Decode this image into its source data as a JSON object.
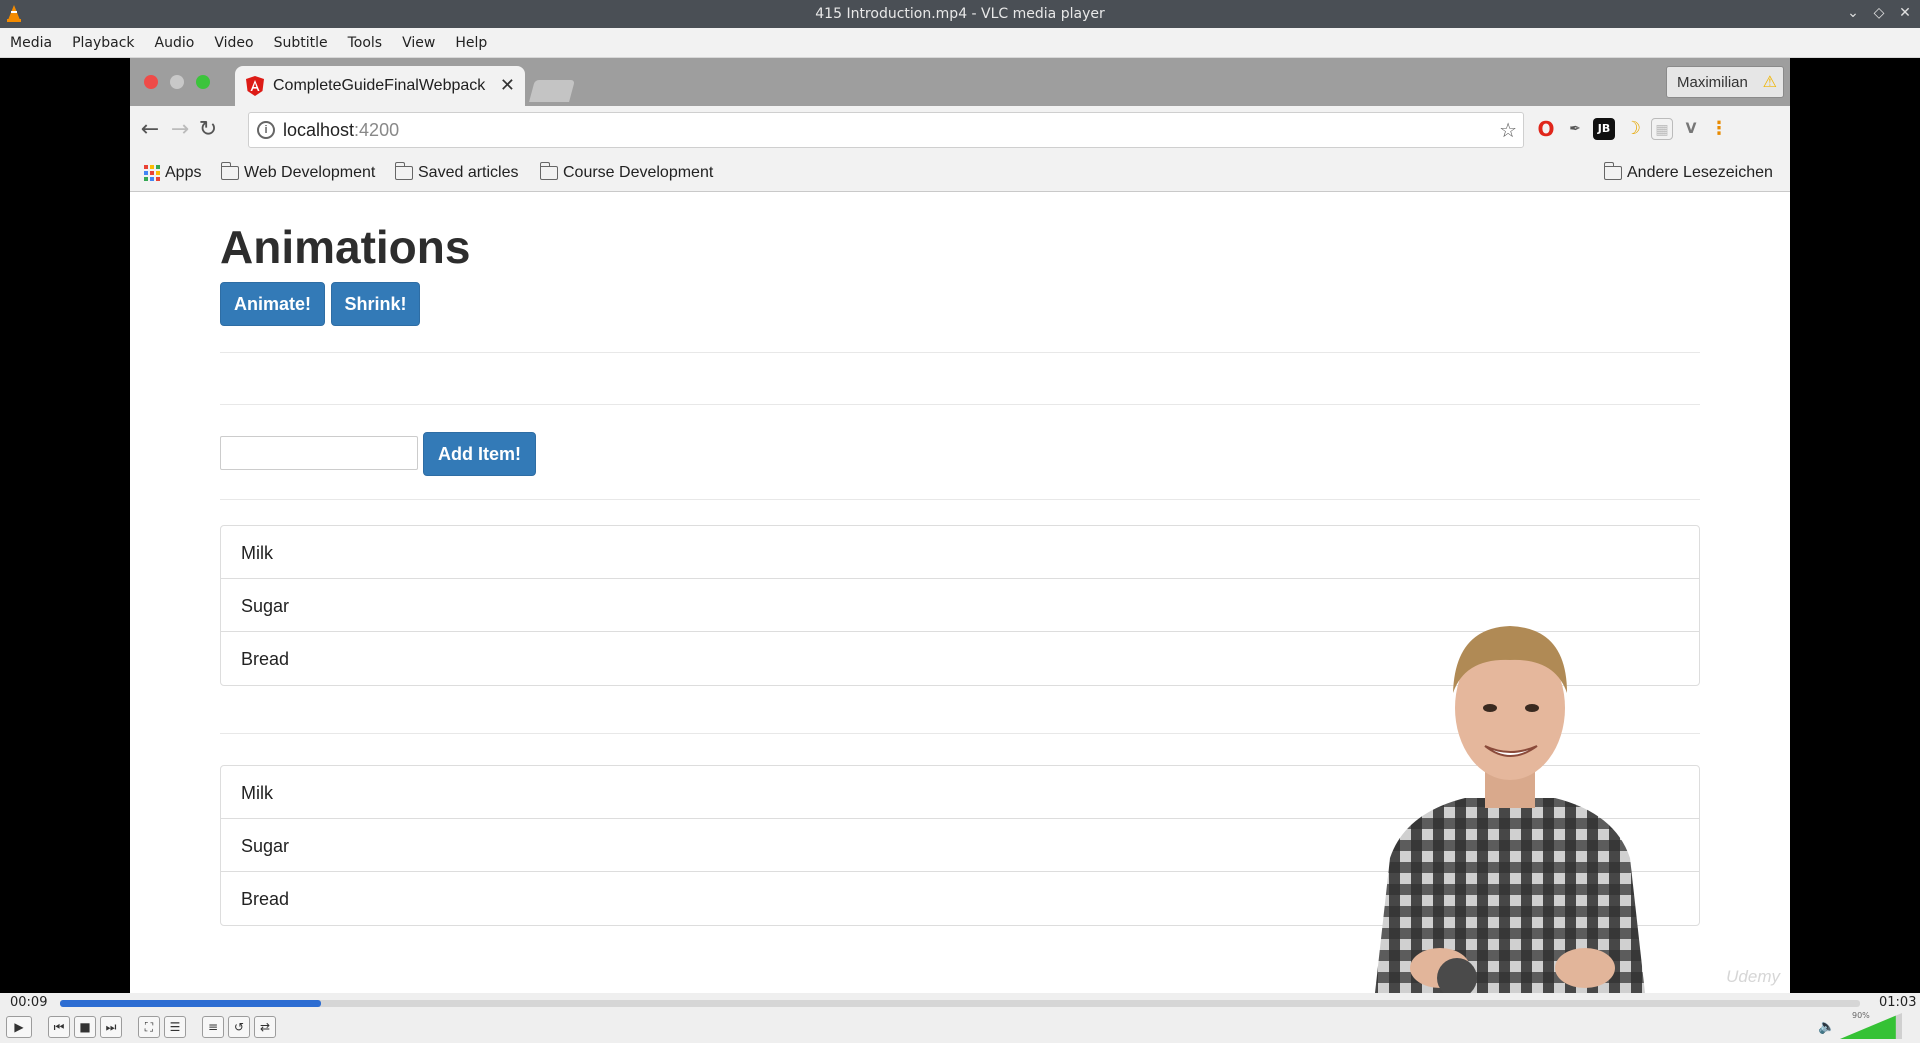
{
  "vlc": {
    "window_title": "415 Introduction.mp4 - VLC media player",
    "menu": [
      "Media",
      "Playback",
      "Audio",
      "Video",
      "Subtitle",
      "Tools",
      "View",
      "Help"
    ],
    "time_elapsed": "00:09",
    "time_total": "01:03",
    "progress": 0.145,
    "volume_label": "90%",
    "volume_level": 0.9
  },
  "browser": {
    "tab_title": "CompleteGuideFinalWebpack",
    "profile_name": "Maximilian",
    "url_host": "localhost",
    "url_port": ":4200",
    "bookmarks": {
      "apps": "Apps",
      "items": [
        "Web Development",
        "Saved articles",
        "Course Development"
      ],
      "other": "Andere Lesezeichen"
    }
  },
  "page": {
    "heading": "Animations",
    "animate_button": "Animate!",
    "shrink_button": "Shrink!",
    "input_value": "",
    "add_button": "Add Item!",
    "list_one": [
      "Milk",
      "Sugar",
      "Bread"
    ],
    "list_two": [
      "Milk",
      "Sugar",
      "Bread"
    ],
    "watermark": "Udemy"
  },
  "colors": {
    "primary_button": "#337ab7",
    "vlc_seek": "#2d6dd2",
    "angular_red": "#dd1b16"
  }
}
